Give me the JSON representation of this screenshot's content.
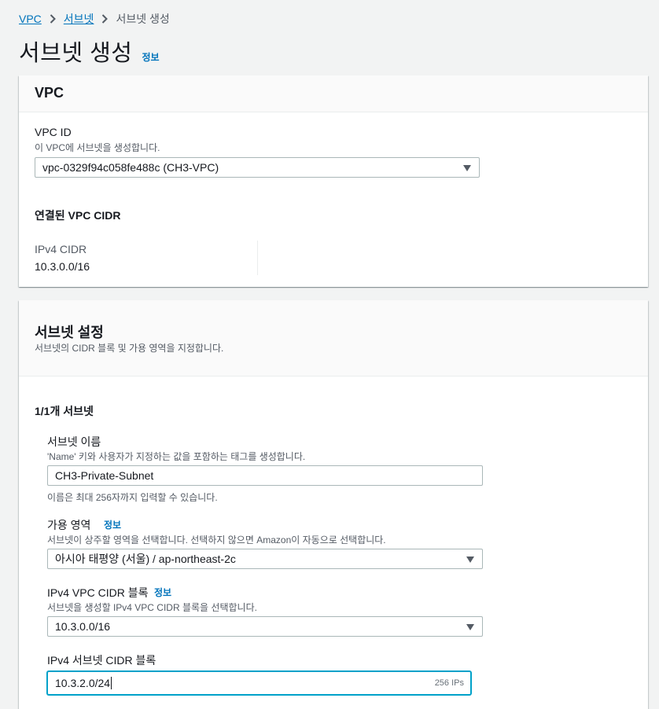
{
  "breadcrumb": {
    "items": [
      "VPC",
      "서브넷"
    ],
    "current": "서브넷 생성"
  },
  "page": {
    "title": "서브넷 생성",
    "info": "정보"
  },
  "vpc_section": {
    "heading": "VPC",
    "vpc_id_label": "VPC ID",
    "vpc_id_desc": "이 VPC에 서브넷을 생성합니다.",
    "vpc_id_value": "vpc-0329f94c058fe488c (CH3-VPC)",
    "cidr_heading": "연결된 VPC CIDR",
    "ipv4_cidr_label": "IPv4 CIDR",
    "ipv4_cidr_value": "10.3.0.0/16"
  },
  "subnet_section": {
    "heading": "서브넷 설정",
    "desc": "서브넷의 CIDR 블록 및 가용 영역을 지정합니다.",
    "count_label": "1/1개 서브넷",
    "name_label": "서브넷 이름",
    "name_desc": "'Name' 키와 사용자가 지정하는 값을 포함하는 태그를 생성합니다.",
    "name_value": "CH3-Private-Subnet",
    "name_hint": "이름은 최대 256자까지 입력할 수 있습니다.",
    "az_label": "가용 영역",
    "az_info": "정보",
    "az_desc": "서브넷이 상주할 영역을 선택합니다. 선택하지 않으면 Amazon이 자동으로 선택합니다.",
    "az_value": "아시아 태평양 (서울) / ap-northeast-2c",
    "vpc_cidr_label": "IPv4 VPC CIDR 블록",
    "vpc_cidr_info": "정보",
    "vpc_cidr_desc": "서브넷을 생성할 IPv4 VPC CIDR 블록을 선택합니다.",
    "vpc_cidr_value": "10.3.0.0/16",
    "subnet_cidr_label": "IPv4 서브넷 CIDR 블록",
    "subnet_cidr_value": "10.3.2.0/24",
    "subnet_cidr_ips": "256 IPs"
  }
}
